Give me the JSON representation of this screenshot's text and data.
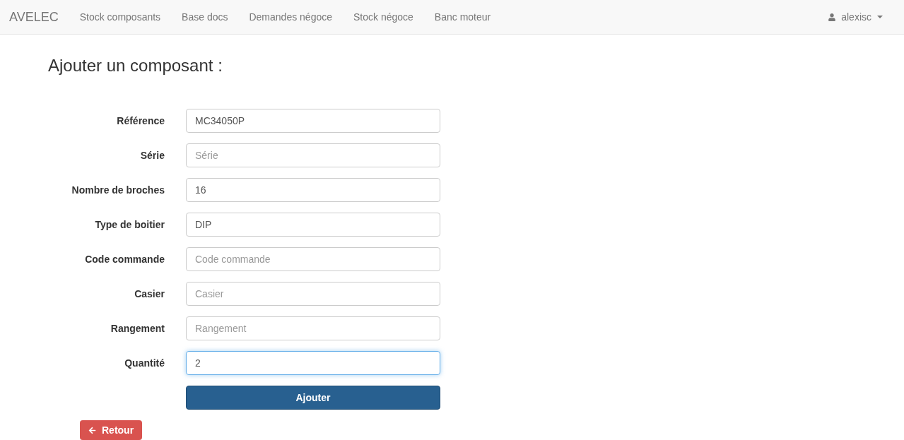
{
  "navbar": {
    "brand": "AVELEC",
    "items": [
      {
        "label": "Stock composants"
      },
      {
        "label": "Base docs"
      },
      {
        "label": "Demandes négoce"
      },
      {
        "label": "Stock négoce"
      },
      {
        "label": "Banc moteur"
      }
    ],
    "user": "alexisc"
  },
  "heading": "Ajouter un composant :",
  "fields": [
    {
      "label": "Référence",
      "value": "MC34050P",
      "focused": false
    },
    {
      "label": "Série",
      "placeholder": "Série",
      "focused": false
    },
    {
      "label": "Nombre de broches",
      "value": "16",
      "focused": false
    },
    {
      "label": "Type de boitier",
      "value": "DIP",
      "focused": false
    },
    {
      "label": "Code commande",
      "placeholder": "Code commande",
      "focused": false
    },
    {
      "label": "Casier",
      "placeholder": "Casier",
      "focused": false
    },
    {
      "label": "Rangement",
      "placeholder": "Rangement",
      "focused": false
    },
    {
      "label": "Quantité",
      "value": "2",
      "focused": true
    }
  ],
  "submit": "Ajouter",
  "back": "Retour"
}
